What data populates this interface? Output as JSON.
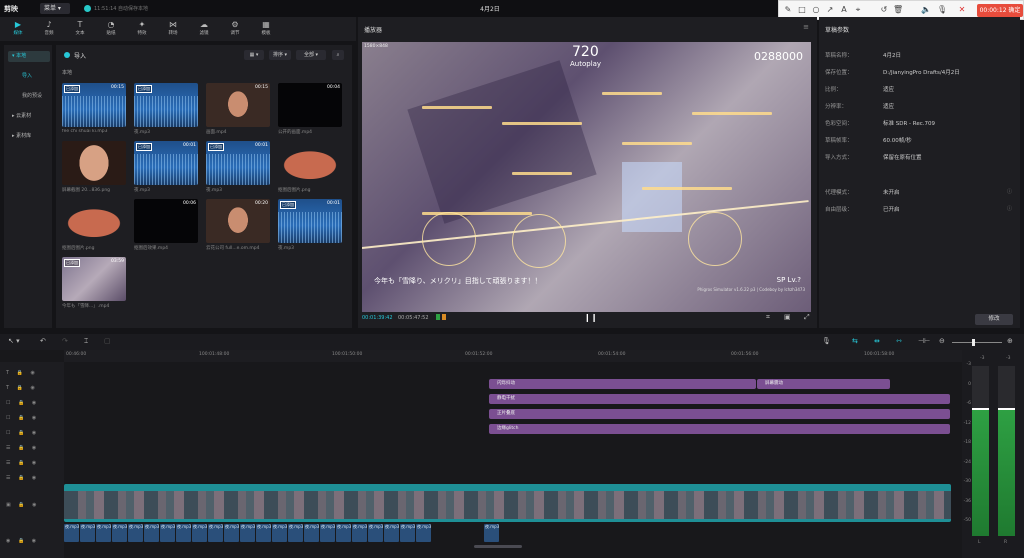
{
  "app": {
    "logo": "剪映",
    "menu_label": "菜单",
    "autosave_text": "11:51:14 自动保存本地",
    "project_title": "4月2日"
  },
  "recorder": {
    "timer_text": "00:00:12 确定",
    "tools": [
      "pen-icon",
      "rect-icon",
      "circle-icon",
      "arrow-icon",
      "text-icon",
      "marker-icon",
      "undo-icon",
      "trash-icon",
      "speaker-icon",
      "mic-icon",
      "close-icon"
    ]
  },
  "media_tools": [
    {
      "label": "媒体",
      "icon": "media-icon",
      "active": true
    },
    {
      "label": "音频",
      "icon": "audio-icon",
      "active": false
    },
    {
      "label": "文本",
      "icon": "text-icon",
      "active": false
    },
    {
      "label": "贴纸",
      "icon": "sticker-icon",
      "active": false
    },
    {
      "label": "特效",
      "icon": "effects-icon",
      "active": false
    },
    {
      "label": "转场",
      "icon": "transition-icon",
      "active": false
    },
    {
      "label": "滤镜",
      "icon": "filter-icon",
      "active": false
    },
    {
      "label": "调节",
      "icon": "adjust-icon",
      "active": false
    },
    {
      "label": "模板",
      "icon": "template-icon",
      "active": false
    }
  ],
  "media_nav": {
    "local": "▾ 本地",
    "import": "导入",
    "my_presets": "我的预设",
    "cloud": "▸ 云素材",
    "library": "▸ 素材库"
  },
  "media_grid": {
    "import_label": "导入",
    "view_btn": "▦ ▾",
    "sort_btn": "排序 ▾",
    "all_btn": "全部 ▾",
    "local_label": "本地",
    "items": [
      {
        "caption": "fee chi shuai ki.mp3",
        "duration": "00:15",
        "badge": "已添加",
        "kind": "wave"
      },
      {
        "caption": "夜.mp3",
        "duration": "",
        "badge": "已添加",
        "kind": "wave"
      },
      {
        "caption": "画面.mp4",
        "duration": "00:15",
        "badge": "",
        "kind": "face"
      },
      {
        "caption": "公开的画面.mp4",
        "duration": "00:04",
        "badge": "",
        "kind": "dark"
      },
      {
        "caption": "屏幕截图 20...836.png",
        "duration": "",
        "badge": "",
        "kind": "face2"
      },
      {
        "caption": "夜.mp3",
        "duration": "00:01",
        "badge": "已添加",
        "kind": "wave"
      },
      {
        "caption": "夜.mp3",
        "duration": "00:01",
        "badge": "已添加",
        "kind": "wave"
      },
      {
        "caption": "抠图后图片.png",
        "duration": "",
        "badge": "",
        "kind": "flesh"
      },
      {
        "caption": "抠图后图片.png",
        "duration": "",
        "badge": "",
        "kind": "flesh"
      },
      {
        "caption": "抠图后效果.mp4",
        "duration": "00:06",
        "badge": "",
        "kind": "dark"
      },
      {
        "caption": "云花公司 full...e.om.mp4",
        "duration": "00:20",
        "badge": "",
        "kind": "face"
      },
      {
        "caption": "夜.mp3",
        "duration": "00:01",
        "badge": "已添加",
        "kind": "wave"
      },
      {
        "caption": "今年も「雪降...」.mp4",
        "duration": "03:59",
        "badge": "已添加",
        "kind": "game"
      }
    ]
  },
  "player": {
    "title": "播放器",
    "resolution": "1580×848",
    "combo": "720",
    "autoplay": "Autoplay",
    "score": "0288000",
    "lyric": "今年も「雪降り、メリクリ」目指して頑張ります！！",
    "level": "SP  Lv.?",
    "sim_text": "Phigros Simulator v1.6.22 p3 | Codeboy by lchzh3473",
    "time_current": "00:01:39:42",
    "time_total": "00:05:47:52",
    "pause_icon": "pause-icon"
  },
  "properties": {
    "title": "草稿参数",
    "rows": [
      {
        "key": "草稿名称：",
        "value": "4月2日",
        "info": false
      },
      {
        "key": "保存位置：",
        "value": "D:/JianyingPro Drafts/4月2日",
        "info": false
      },
      {
        "key": "比例：",
        "value": "适应",
        "info": false
      },
      {
        "key": "分辨率：",
        "value": "适应",
        "info": false
      },
      {
        "key": "色彩空间：",
        "value": "标准 SDR - Rec.709",
        "info": false
      },
      {
        "key": "草稿帧率：",
        "value": "60.00帧/秒",
        "info": false
      },
      {
        "key": "导入方式：",
        "value": "保留在原有位置",
        "info": false
      },
      {
        "key": "代理模式：",
        "value": "未开启",
        "info": true
      },
      {
        "key": "自由层级：",
        "value": "已开启",
        "info": true
      }
    ],
    "modify_btn": "修改"
  },
  "timeline": {
    "ruler_labels": [
      "00:46:00",
      "100:01:48:00",
      "100:01:50:00",
      "00:01:52:00",
      "00:01:54:00",
      "00:01:56:00",
      "100:01:58:00"
    ],
    "fx_clips": [
      {
        "label": "闪烁抖动",
        "row": 0,
        "start": 489,
        "end": 757
      },
      {
        "label": "屏幕震动",
        "row": 0,
        "start": 757,
        "end": 891
      },
      {
        "label": "静电干扰",
        "row": 1,
        "start": 489,
        "end": 951
      },
      {
        "label": "正片叠底",
        "row": 2,
        "start": 489,
        "end": 951
      },
      {
        "label": "边缘glitch",
        "row": 3,
        "start": 489,
        "end": 951
      }
    ],
    "audio_label": "夜.mp3"
  },
  "meters": {
    "db_labels": [
      "-3",
      "0",
      "-6",
      "-12",
      "-18",
      "-24",
      "-30",
      "-36",
      "-50"
    ],
    "channels": [
      "L",
      "R"
    ],
    "level_left": 0.74,
    "level_right": 0.74,
    "top_labels": [
      "-3",
      "-3"
    ]
  }
}
